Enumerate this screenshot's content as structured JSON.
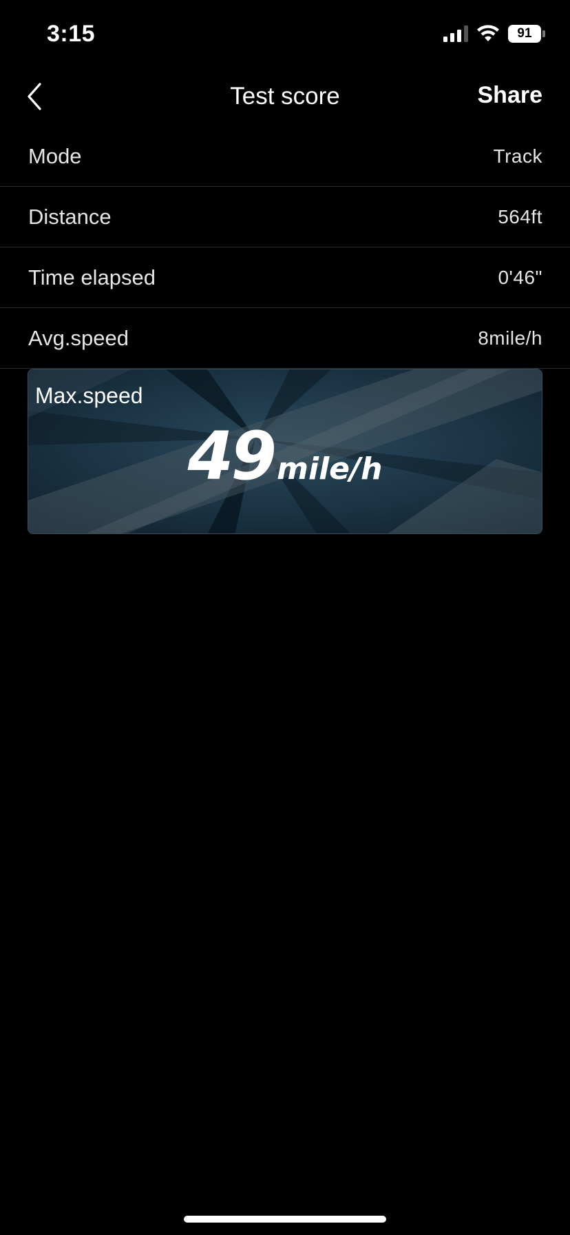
{
  "status_bar": {
    "time": "3:15",
    "battery": "91"
  },
  "nav": {
    "title": "Test score",
    "share_label": "Share"
  },
  "rows": [
    {
      "label": "Mode",
      "value": "Track"
    },
    {
      "label": "Distance",
      "value": "564ft"
    },
    {
      "label": "Time elapsed",
      "value": "0'46\""
    },
    {
      "label": "Avg.speed",
      "value": "8mile/h"
    }
  ],
  "max_speed": {
    "label": "Max.speed",
    "value": "49",
    "unit": "mile/h"
  },
  "colors": {
    "background": "#000000",
    "card_blue": "#1d3a4c",
    "divider": "#2a2a2a"
  }
}
